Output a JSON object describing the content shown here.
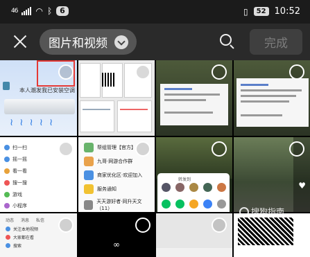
{
  "status_bar": {
    "signal": "46",
    "notification_count": "6",
    "battery": "52",
    "time": "10:52"
  },
  "header": {
    "album_label": "图片和视频",
    "done_label": "完成"
  },
  "grid": {
    "cells": [
      {
        "caption": "本人潮发我已安装空调"
      },
      {
        "caption": ""
      },
      {
        "caption": ""
      },
      {
        "caption": ""
      },
      {
        "menu": [
          "扫一扫",
          "摇一摇",
          "看一看",
          "搜一搜",
          "游戏",
          "小程序"
        ]
      },
      {
        "chats": [
          "帮组管理【官方】",
          "九哥·网游合作群",
          "商家优化区·欢迎加入",
          "服务通知",
          "天天游好者·同升天文（11）"
        ]
      },
      {
        "sheet_title": "转发到"
      },
      {
        "caption": ""
      },
      {
        "tabs": [
          "动态",
          "消息",
          "私信"
        ],
        "rows": [
          "关注本地视频",
          "大家都在看",
          "搜索"
        ]
      },
      {
        "glyph": "∞"
      },
      {
        "caption": ""
      },
      {
        "caption": ""
      }
    ]
  },
  "watermark": "搜狗指南"
}
